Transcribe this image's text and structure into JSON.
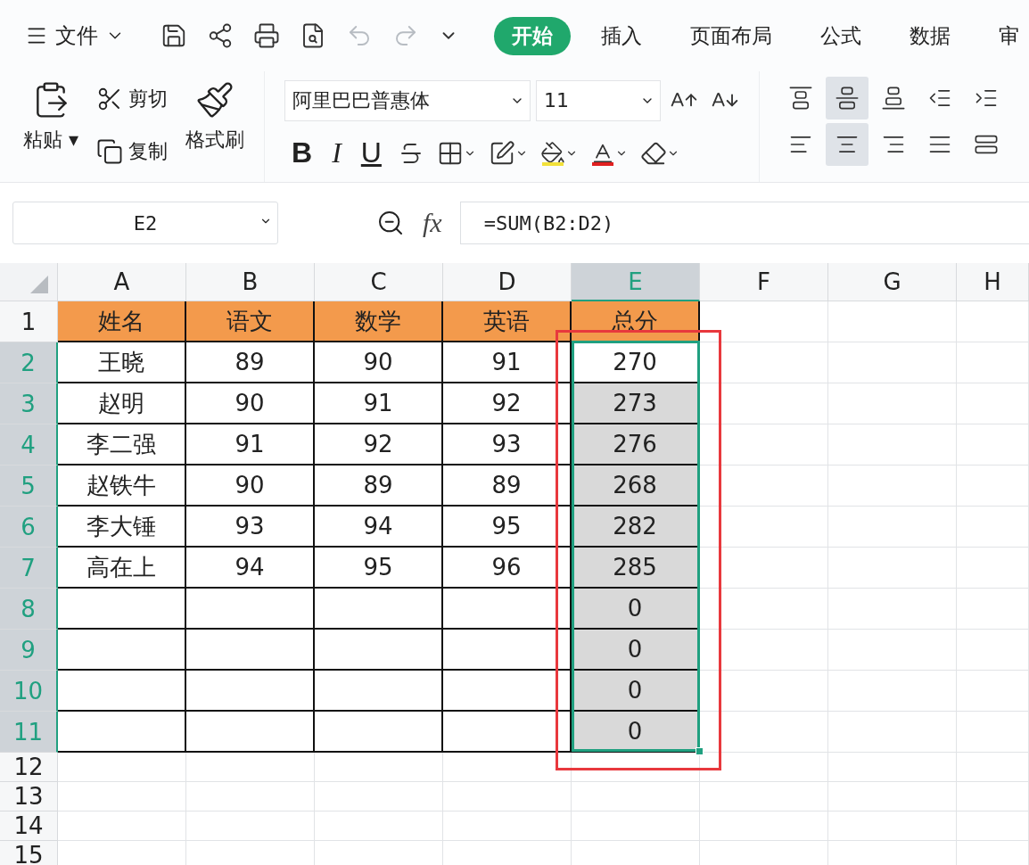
{
  "menu": {
    "label": "文件"
  },
  "tabs": [
    {
      "label": "开始",
      "selected": true
    },
    {
      "label": "插入",
      "selected": false
    },
    {
      "label": "页面布局",
      "selected": false
    },
    {
      "label": "公式",
      "selected": false
    },
    {
      "label": "数据",
      "selected": false
    },
    {
      "label": "审",
      "selected": false
    }
  ],
  "clipboard": {
    "paste": "粘贴",
    "paste_caret": "▾",
    "cut": "剪切",
    "copy": "复制",
    "format_painter": "格式刷"
  },
  "font": {
    "name": "阿里巴巴普惠体",
    "size": "11",
    "bold": "B",
    "italic": "I",
    "underline": "U"
  },
  "align_buttons": [
    {
      "kind": "top",
      "selected": false
    },
    {
      "kind": "middle",
      "selected": true
    },
    {
      "kind": "bottom",
      "selected": false
    },
    {
      "kind": "outdent",
      "selected": false
    },
    {
      "kind": "indent",
      "selected": false
    },
    {
      "kind": "left",
      "selected": false
    },
    {
      "kind": "center",
      "selected": true
    },
    {
      "kind": "right",
      "selected": false
    },
    {
      "kind": "justify",
      "selected": false
    },
    {
      "kind": "distributed",
      "selected": false
    }
  ],
  "name_box": {
    "value": "E2"
  },
  "formula_bar": {
    "fx": "fx",
    "value": "=SUM(B2:D2)"
  },
  "sheet": {
    "columns": [
      {
        "label": "A",
        "selected": false
      },
      {
        "label": "B",
        "selected": false
      },
      {
        "label": "C",
        "selected": false
      },
      {
        "label": "D",
        "selected": false
      },
      {
        "label": "E",
        "selected": true
      },
      {
        "label": "F",
        "selected": false
      },
      {
        "label": "G",
        "selected": false
      },
      {
        "label": "H",
        "selected": false
      }
    ],
    "rows": [
      {
        "header": "1",
        "selected": false,
        "cells": {
          "A": "姓名",
          "B": "语文",
          "C": "数学",
          "D": "英语",
          "E": "总分"
        }
      },
      {
        "header": "2",
        "selected": true,
        "cells": {
          "A": "王晓",
          "B": "89",
          "C": "90",
          "D": "91",
          "E": "270"
        }
      },
      {
        "header": "3",
        "selected": true,
        "cells": {
          "A": "赵明",
          "B": "90",
          "C": "91",
          "D": "92",
          "E": "273"
        }
      },
      {
        "header": "4",
        "selected": true,
        "cells": {
          "A": "李二强",
          "B": "91",
          "C": "92",
          "D": "93",
          "E": "276"
        }
      },
      {
        "header": "5",
        "selected": true,
        "cells": {
          "A": "赵铁牛",
          "B": "90",
          "C": "89",
          "D": "89",
          "E": "268"
        }
      },
      {
        "header": "6",
        "selected": true,
        "cells": {
          "A": "李大锤",
          "B": "93",
          "C": "94",
          "D": "95",
          "E": "282"
        }
      },
      {
        "header": "7",
        "selected": true,
        "cells": {
          "A": "高在上",
          "B": "94",
          "C": "95",
          "D": "96",
          "E": "285"
        }
      },
      {
        "header": "8",
        "selected": true,
        "cells": {
          "E": "0"
        }
      },
      {
        "header": "9",
        "selected": true,
        "cells": {
          "E": "0"
        }
      },
      {
        "header": "10",
        "selected": true,
        "cells": {
          "E": "0"
        }
      },
      {
        "header": "11",
        "selected": true,
        "cells": {
          "E": "0"
        }
      },
      {
        "header": "12",
        "selected": false
      },
      {
        "header": "13",
        "selected": false
      },
      {
        "header": "14",
        "selected": false
      },
      {
        "header": "15",
        "selected": false
      }
    ]
  }
}
